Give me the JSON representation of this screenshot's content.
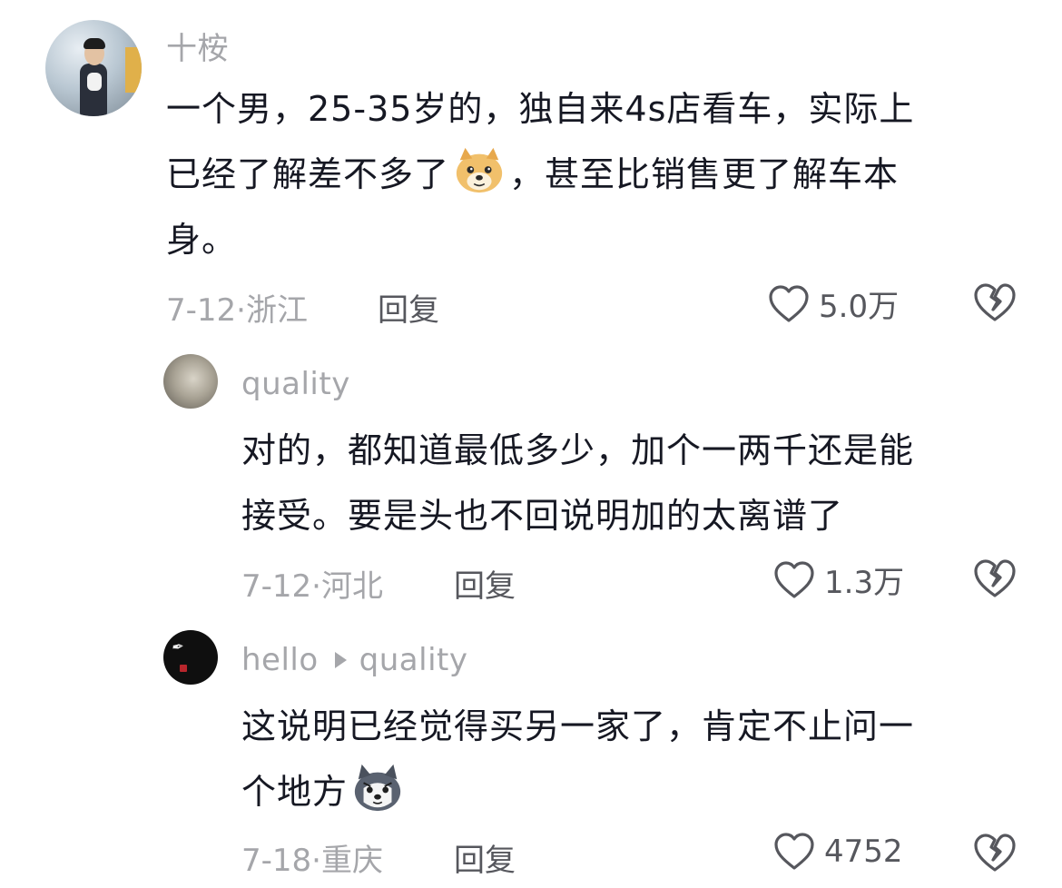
{
  "comments": [
    {
      "username": "十桉",
      "text_line1": "一个男，25-35岁的，独自来4s店看车，实际上",
      "text_line2a": "已经了解差不多了",
      "emoji": "doge-icon",
      "text_line2b": "，甚至比销售更了解车本",
      "text_line3": "身。",
      "meta": "7-12·浙江",
      "reply_label": "回复",
      "likes": "5.0万"
    },
    {
      "username": "quality",
      "text_line1": "对的，都知道最低多少，加个一两千还是能",
      "text_line2": "接受。要是头也不回说明加的太离谱了",
      "meta": "7-12·河北",
      "reply_label": "回复",
      "likes": "1.3万"
    },
    {
      "username": "hello",
      "reply_to": "quality",
      "text_line1": "这说明已经觉得买另一家了，肯定不止问一",
      "text_line2": "个地方",
      "emoji": "husky-icon",
      "meta": "7-18·重庆",
      "reply_label": "回复",
      "likes": "4752"
    }
  ],
  "colors": {
    "text": "#161823",
    "secondary": "#a5a6aa",
    "action": "#56575d"
  }
}
